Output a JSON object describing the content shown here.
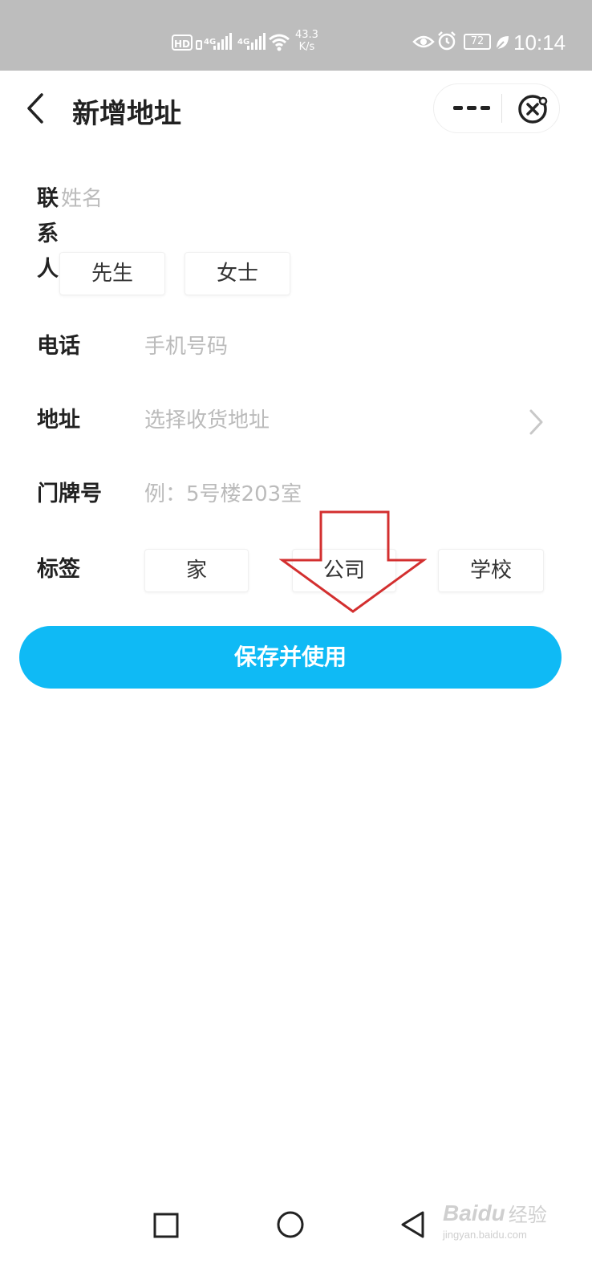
{
  "status_bar": {
    "hd": "HD",
    "signal1": "4G",
    "signal2": "4G",
    "speed_value": "43.3",
    "speed_unit": "K/s",
    "battery": "72",
    "time": "10:14"
  },
  "header": {
    "title": "新增地址"
  },
  "form": {
    "contact_label": [
      "联",
      "系",
      "人"
    ],
    "name_placeholder": "姓名",
    "gender_options": [
      "先生",
      "女士"
    ],
    "phone_label": "电话",
    "phone_placeholder": "手机号码",
    "address_label": "地址",
    "address_placeholder": "选择收货地址",
    "door_label": "门牌号",
    "door_placeholder": "例：5号楼203室",
    "tag_label": "标签",
    "tags": [
      "家",
      "公司",
      "学校"
    ]
  },
  "save_label": "保存并使用",
  "watermark": {
    "brand": "Baidu",
    "brand_suffix": "经验",
    "site": "jingyan.baidu.com"
  },
  "colors": {
    "primary": "#0fbaf5",
    "status_bar": "#bdbdbd",
    "placeholder": "#bbbbbb",
    "annotation": "#d32f2f"
  }
}
